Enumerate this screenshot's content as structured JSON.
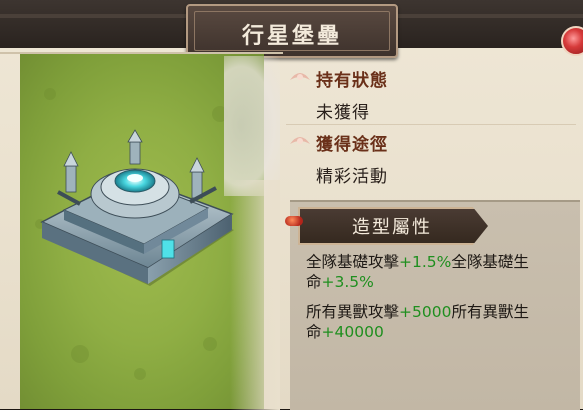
{
  "window": {
    "title": "行星堡壘"
  },
  "status": {
    "label": "持有狀態",
    "value": "未獲得"
  },
  "acquire": {
    "label": "獲得途徑",
    "value": "精彩活動"
  },
  "attributes": {
    "header": "造型屬性",
    "lines": [
      {
        "stat1": "全隊基礎攻擊",
        "bonus1": "+1.5%",
        "stat2": "全隊基礎生",
        "stat2b": "命",
        "bonus2": "+3.5%"
      },
      {
        "stat1": "所有異獸攻擊",
        "bonus1": "+5000",
        "stat2": "所有異獸生",
        "stat2b": "命",
        "bonus2": "+40000"
      }
    ]
  },
  "colors": {
    "bonus": "#1f8f1f",
    "label": "#6a3019",
    "header_bg": "#3e3028"
  },
  "icons": {
    "flower_label": "lotus-icon",
    "item": "planet-fortress-building-icon"
  }
}
